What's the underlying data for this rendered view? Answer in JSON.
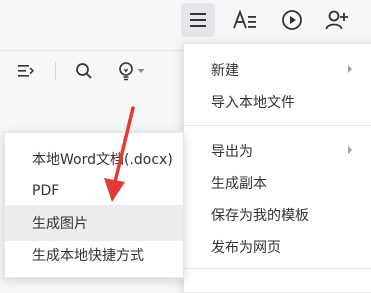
{
  "topbar": {
    "icons": [
      "menu-icon",
      "text-format-icon",
      "play-icon",
      "add-user-icon"
    ]
  },
  "toolbar": {
    "icons": [
      "outline-icon",
      "search-icon",
      "lightbulb-icon",
      "dropdown-caret-icon"
    ]
  },
  "main_menu": {
    "items": [
      {
        "label": "新建",
        "has_submenu": true
      },
      {
        "label": "导入本地文件",
        "has_submenu": false
      },
      {
        "label": "导出为",
        "has_submenu": true
      },
      {
        "label": "生成副本",
        "has_submenu": false
      },
      {
        "label": "保存为我的模板",
        "has_submenu": false
      },
      {
        "label": "发布为网页",
        "has_submenu": false
      }
    ]
  },
  "export_submenu": {
    "items": [
      {
        "label": "本地Word文档(.docx)"
      },
      {
        "label": "PDF"
      },
      {
        "label": "生成图片"
      },
      {
        "label": "生成本地快捷方式"
      }
    ]
  },
  "colors": {
    "accent_arrow": "#e53935",
    "menu_hover": "#ededed",
    "background": "#f6f7f9"
  }
}
